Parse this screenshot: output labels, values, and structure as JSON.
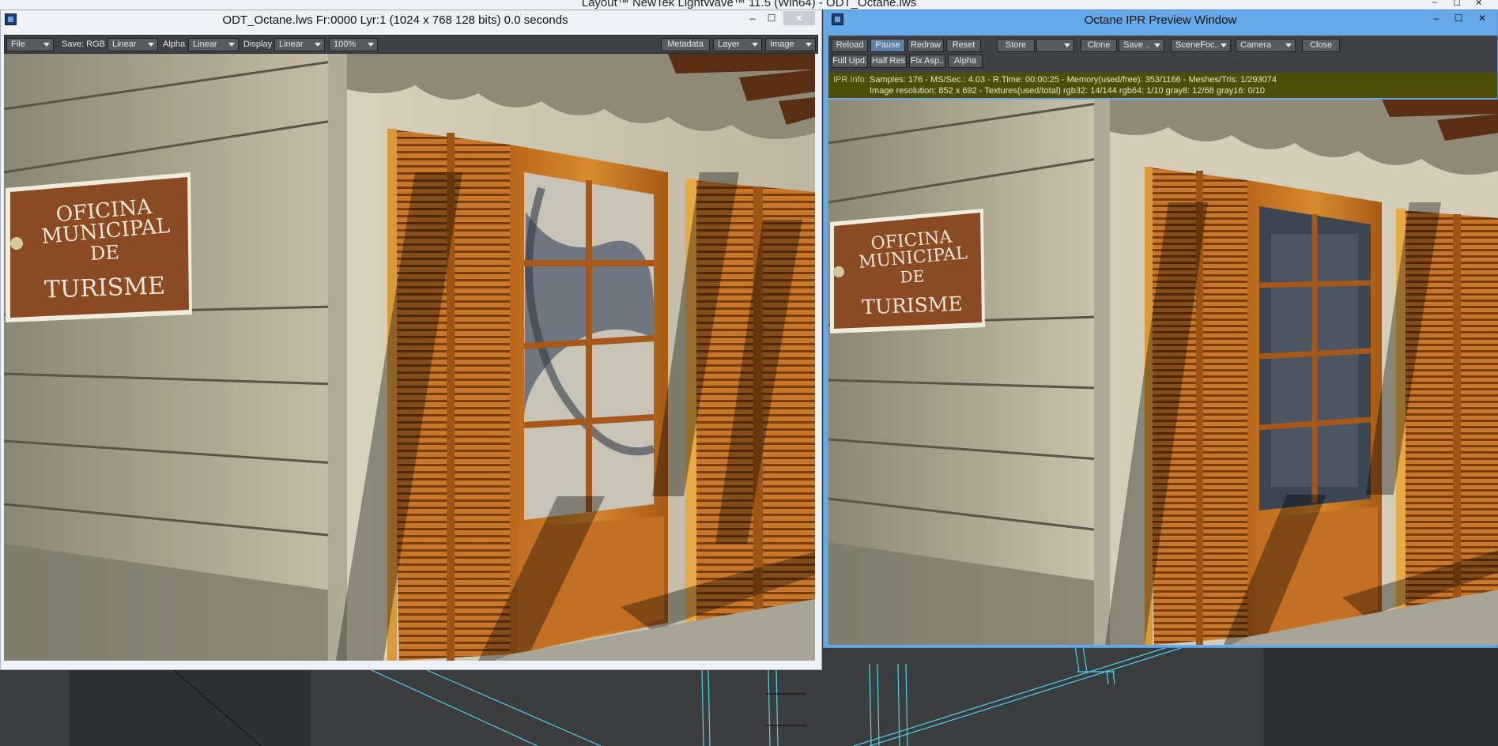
{
  "background": {
    "title": "Layout™ NewTek LightWave™ 11.5 (Win64) - ODT_Octane.lws",
    "controls": [
      "–",
      "☐",
      "✕"
    ]
  },
  "viewer": {
    "title": "ODT_Octane.lws Fr:0000 Lyr:1  (1024 x 768 128 bits) 0.0 seconds",
    "controls": {
      "minimize": "–",
      "maximize": "☐",
      "close": "✕"
    },
    "toolbar": {
      "file": "File",
      "save_label": "Save: RGB",
      "save_value": "Linear",
      "alpha_label": "Alpha",
      "alpha_value": "Linear",
      "display_label": "Display",
      "display_value": "Linear",
      "zoom": "100%",
      "metadata": "Metadata",
      "layer": "Layer",
      "image": "Image"
    },
    "sign": {
      "line1": "OFICINA MUNICIPAL",
      "line2": "DE",
      "line3": "TURISME"
    }
  },
  "ipr": {
    "title": "Octane IPR Preview Window",
    "controls": {
      "minimize": "–",
      "maximize": "☐",
      "close": "✕"
    },
    "row1": {
      "reload": "Reload",
      "pause": "Pause",
      "redraw": "Redraw",
      "reset": "Reset",
      "store": "Store",
      "store_select": "",
      "clone": "Clone",
      "save": "Save ..",
      "scene_focus": "SceneFoc..",
      "camera": "Camera",
      "close": "Close"
    },
    "row2": {
      "full_update": "Full Upd..",
      "half_res": "Half Res",
      "fix_aspect": "Fix Asp..",
      "alpha": "Alpha"
    },
    "info": {
      "label": "IPR Info:",
      "line1": "Samples: 176  -  MS/Sec.: 4.03  -  R.Time: 00:00:25 - Memory(used/free): 353/1166  -  Meshes/Tris: 1/293074",
      "line2": "Image resolution: 852 x 692 - Textures(used/total) rgb32: 14/144   rgb64: 1/10   gray8: 12/68   gray16: 0/10"
    },
    "sign": {
      "line1": "OFICINA MUNICIPAL",
      "line2": "DE",
      "line3": "TURISME"
    }
  },
  "colors": {
    "window_chrome": "#eef1f5",
    "ipr_chrome": "#65a9e8",
    "toolbar": "#3f4144",
    "button": "#575a5e",
    "active_button": "#5e7fa6",
    "info_bar": "#4f4e08",
    "wireframe": "#4fd3e6"
  }
}
